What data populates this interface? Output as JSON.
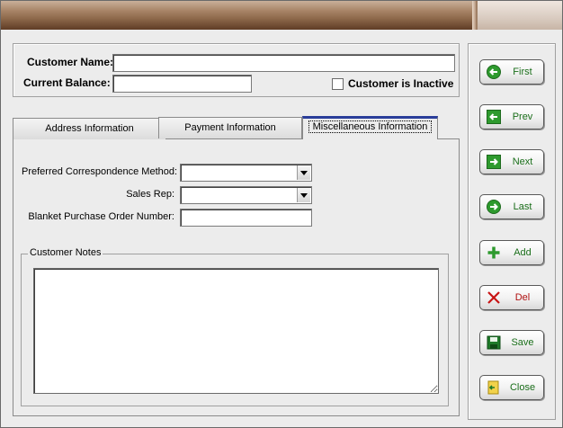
{
  "header": {
    "customer_name_label": "Customer Name:",
    "customer_name_value": "",
    "current_balance_label": "Current Balance:",
    "current_balance_value": "",
    "inactive_label": "Customer is Inactive",
    "inactive_checked": false
  },
  "tabs": [
    {
      "label": "Address Information"
    },
    {
      "label": "Payment Information"
    },
    {
      "label": "Miscellaneous Information",
      "active": true
    }
  ],
  "misc": {
    "preferred_label": "Preferred Correspondence Method:",
    "preferred_value": "",
    "sales_rep_label": "Sales Rep:",
    "sales_rep_value": "",
    "blanket_po_label": "Blanket Purchase Order Number:",
    "blanket_po_value": "",
    "notes_label": "Customer Notes",
    "notes_value": ""
  },
  "nav": {
    "first": "First",
    "prev": "Prev",
    "next": "Next",
    "last": "Last",
    "add": "Add",
    "del": "Del",
    "save": "Save",
    "close": "Close"
  },
  "colors": {
    "accent_tab": "#2a3e9a",
    "nav_text_green": "#1a6e1a",
    "nav_text_red": "#b01010"
  }
}
